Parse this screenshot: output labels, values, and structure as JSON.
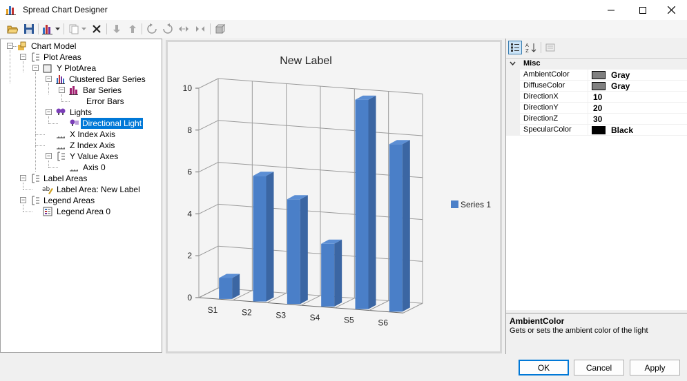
{
  "window": {
    "title": "Spread Chart Designer"
  },
  "toolbar": {
    "icons": [
      "open-icon",
      "save-icon",
      "chart-type-icon",
      "dropdown-icon",
      "copy-icon",
      "dropdown-icon",
      "delete-icon",
      "move-down-icon",
      "move-up-icon",
      "rotate-left-icon",
      "rotate-right-icon",
      "left-right-icon",
      "right-left-icon",
      "3d-view-icon"
    ]
  },
  "tree": {
    "items": [
      {
        "label": "Chart Model"
      },
      {
        "label": "Plot Areas"
      },
      {
        "label": "Y PlotArea"
      },
      {
        "label": "Clustered Bar Series"
      },
      {
        "label": "Bar Series"
      },
      {
        "label": "Error Bars"
      },
      {
        "label": "Lights"
      },
      {
        "label": "Directional Light",
        "selected": true
      },
      {
        "label": "X Index Axis"
      },
      {
        "label": "Z Index Axis"
      },
      {
        "label": "Y Value Axes"
      },
      {
        "label": "Axis 0"
      },
      {
        "label": "Label Areas"
      },
      {
        "label": "Label Area: New Label"
      },
      {
        "label": "Legend Areas"
      },
      {
        "label": "Legend Area 0"
      }
    ]
  },
  "chart_data": {
    "type": "bar",
    "title": "New Label",
    "categories": [
      "S1",
      "S2",
      "S3",
      "S4",
      "S5",
      "S6"
    ],
    "series": [
      {
        "name": "Series 1",
        "color": "#4a7fc8",
        "values": [
          1,
          6,
          5,
          3,
          10,
          8
        ]
      }
    ],
    "ylim": [
      0,
      10
    ],
    "yticks": [
      "0",
      "2",
      "4",
      "6",
      "8",
      "10"
    ],
    "grid": true,
    "legend": "right",
    "style": "3d"
  },
  "properties": {
    "category": "Misc",
    "rows": [
      {
        "name": "AmbientColor",
        "value": "Gray",
        "swatch": "#808080"
      },
      {
        "name": "DiffuseColor",
        "value": "Gray",
        "swatch": "#808080"
      },
      {
        "name": "DirectionX",
        "value": "10"
      },
      {
        "name": "DirectionY",
        "value": "20"
      },
      {
        "name": "DirectionZ",
        "value": "30"
      },
      {
        "name": "SpecularColor",
        "value": "Black",
        "swatch": "#000000"
      }
    ],
    "description_title": "AmbientColor",
    "description_text": "Gets or sets the ambient color of the light"
  },
  "buttons": {
    "ok": "OK",
    "cancel": "Cancel",
    "apply": "Apply"
  }
}
